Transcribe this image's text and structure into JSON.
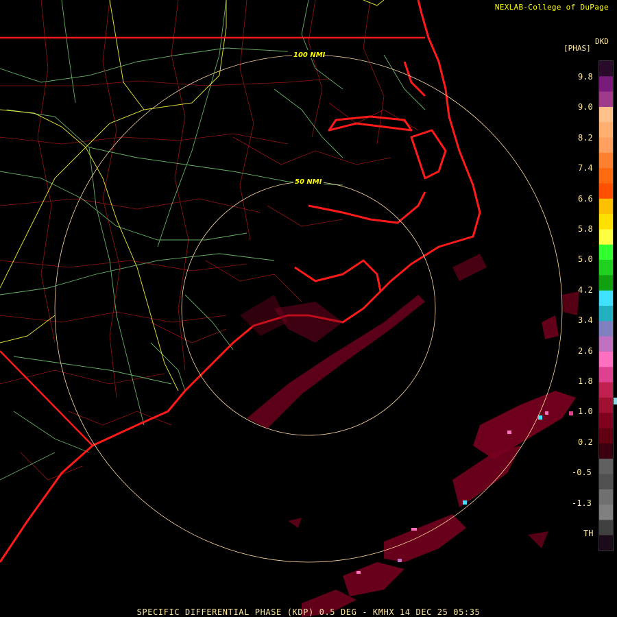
{
  "credit": "NEXLAB-College of DuPage",
  "colorbar": {
    "units_top": "DKD",
    "units_label": "[PHAS]",
    "labels": [
      "9.8",
      "9.0",
      "8.2",
      "7.4",
      "6.6",
      "5.8",
      "5.0",
      "4.2",
      "3.4",
      "2.6",
      "1.8",
      "1.0",
      "0.2",
      "-0.5",
      "-1.3",
      "TH"
    ],
    "colors": [
      "#2a0a2a",
      "#7a1a7a",
      "#a03a8a",
      "#ffc08a",
      "#ffb070",
      "#ffa060",
      "#ff8030",
      "#ff6a10",
      "#ff5000",
      "#ffc000",
      "#ffe000",
      "#ffff40",
      "#30ff30",
      "#20d020",
      "#10a010",
      "#40e0ff",
      "#20b0c0",
      "#8080c0",
      "#c070c0",
      "#ff70c0",
      "#e04090",
      "#c02050",
      "#a01030",
      "#800020",
      "#600010",
      "#3a0010",
      "#606060",
      "#505050",
      "#707070",
      "#808080",
      "#404040",
      "#1a0a1a"
    ]
  },
  "ring_labels": {
    "inner": "50 NMI",
    "outer": "100 NMI"
  },
  "footer": "SPECIFIC DIFFERENTIAL PHASE (KDP) 0.5 DEG - KMHX 14 DEC 25 05:35",
  "colors": {
    "coast": "#ff1a1a",
    "county": "#c01818",
    "roads_green": "#7fdc7f",
    "roads_yellow": "#ffff40",
    "range_ring": "#ffd9a0",
    "echo": "#7a0020"
  }
}
